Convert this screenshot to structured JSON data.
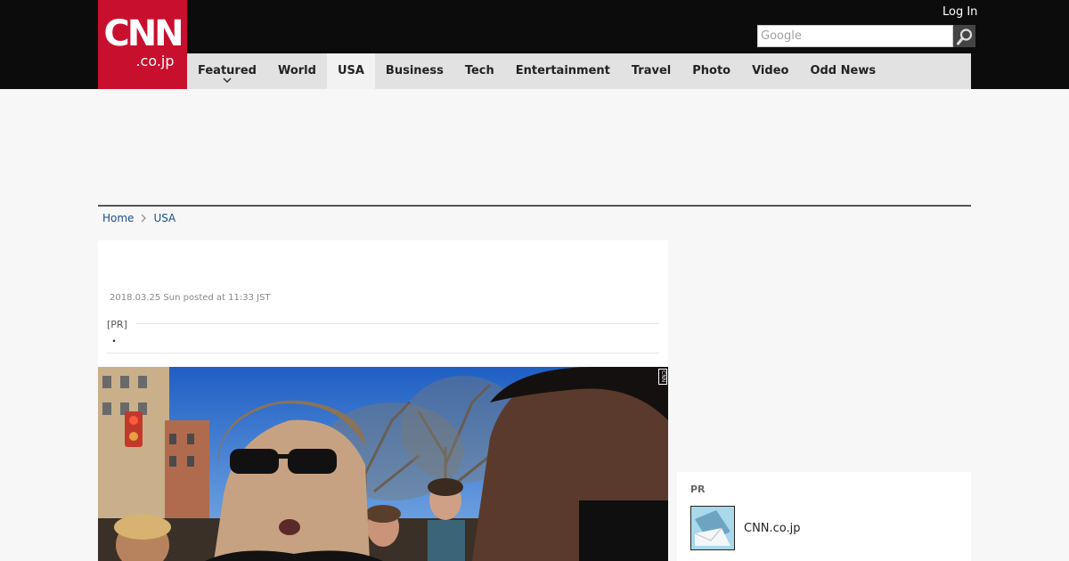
{
  "header": {
    "logo_main": "CNN",
    "logo_sub": ".co.jp",
    "login_label": "Log In",
    "search_placeholder": "Google"
  },
  "nav": {
    "items": [
      "Featured",
      "World",
      "USA",
      "Business",
      "Tech",
      "Entertainment",
      "Travel",
      "Photo",
      "Video",
      "Odd News"
    ],
    "active": "USA"
  },
  "breadcrumb": {
    "home": "Home",
    "section": "USA"
  },
  "article": {
    "date": "2018.03.25 Sun posted at 11:33 JST",
    "pr_label": "[PR]",
    "pr_text": "・"
  },
  "watermark": "CNN",
  "sidebar": {
    "pr_label": "PR",
    "pr_title": "CNN.co.jp"
  },
  "colors": {
    "brand_red": "#c8102e",
    "topbar": "#0c0c0c",
    "nav_bg": "#e2e2e2",
    "link": "#1a4f87"
  },
  "icons": {
    "search": "search-icon",
    "chevron": "chevron-down-icon",
    "breadcrumb_sep": "chevron-right-icon"
  }
}
